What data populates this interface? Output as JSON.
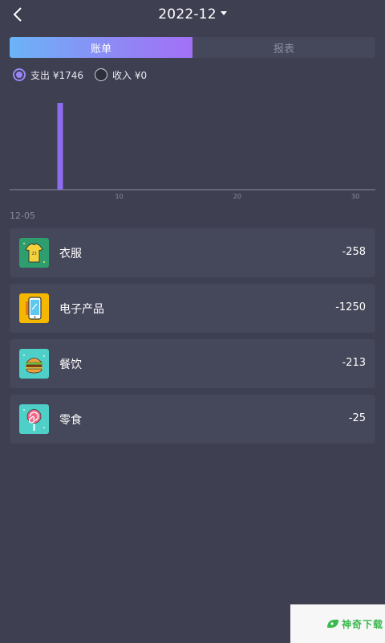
{
  "header": {
    "title": "2022-12",
    "back_icon": "chevron-left-icon",
    "caret_icon": "caret-down-icon"
  },
  "tabs": [
    {
      "label": "账单",
      "active": true
    },
    {
      "label": "报表",
      "active": false
    }
  ],
  "radios": [
    {
      "label": "支出 ¥1746",
      "selected": true
    },
    {
      "label": "收入 ¥0",
      "selected": false
    }
  ],
  "chart_data": {
    "type": "bar",
    "x": [
      5
    ],
    "values": [
      1746
    ],
    "xlim": [
      1,
      31
    ],
    "xticks": [
      "10",
      "20",
      "30"
    ],
    "bar_color": "#8c6cf2"
  },
  "date_group": "12-05",
  "items": [
    {
      "name": "衣服",
      "amount": "-258",
      "icon": "tshirt-icon",
      "icon_bg": "#2e9e6e"
    },
    {
      "name": "电子产品",
      "amount": "-1250",
      "icon": "phone-icon",
      "icon_bg": "#f5b800"
    },
    {
      "name": "餐饮",
      "amount": "-213",
      "icon": "burger-icon",
      "icon_bg": "#4ed0c8"
    },
    {
      "name": "零食",
      "amount": "-25",
      "icon": "lollipop-icon",
      "icon_bg": "#4ed0c8"
    }
  ],
  "watermark": {
    "text": "神奇下载"
  },
  "colors": {
    "background": "#3e3f51",
    "card": "#45475a",
    "accent": "#9a86f6"
  }
}
